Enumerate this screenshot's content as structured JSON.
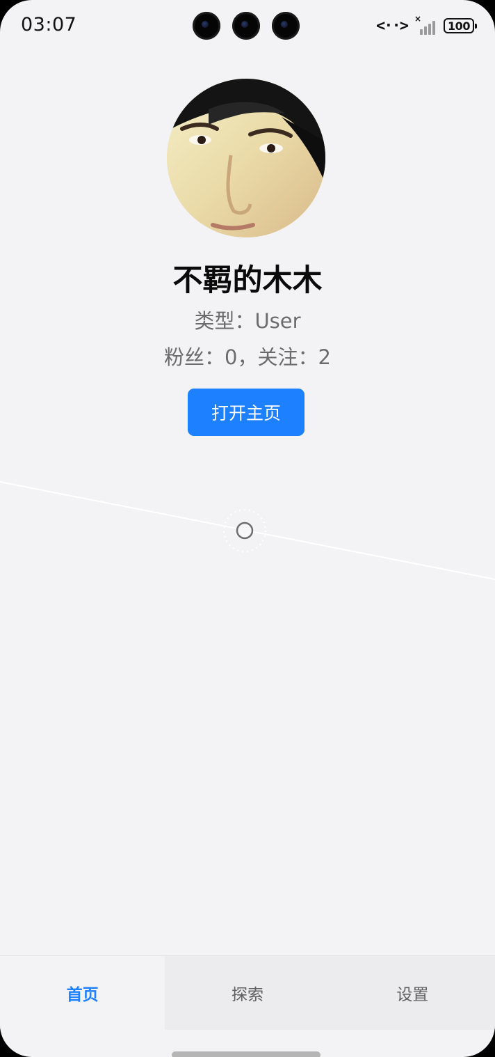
{
  "status_bar": {
    "time": "03:07",
    "data_indicator": "<··>",
    "battery": "100"
  },
  "profile": {
    "name": "不羁的木木",
    "type_line": "类型：User",
    "stats_line": "粉丝：0，关注：2",
    "open_button_label": "打开主页"
  },
  "tabs": [
    {
      "label": "首页",
      "active": true
    },
    {
      "label": "探索",
      "active": false
    },
    {
      "label": "设置",
      "active": false
    }
  ],
  "colors": {
    "accent": "#1d80ff",
    "background": "#f3f3f5",
    "text_primary": "#0a0a0a",
    "text_secondary": "#6b6b6b"
  },
  "icons": {
    "data": "data-transfer-icon",
    "signal": "cellular-signal-no-service-icon",
    "battery": "battery-icon",
    "loading": "loading-spinner-icon"
  }
}
